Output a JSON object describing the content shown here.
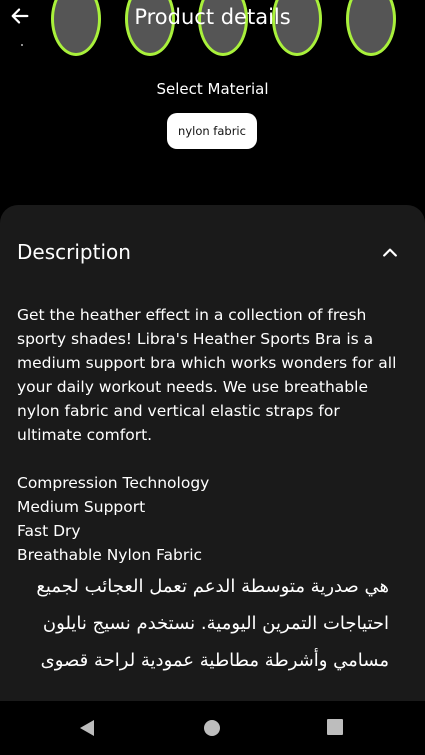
{
  "header": {
    "title": "Product details",
    "back_icon": "arrow-left-icon"
  },
  "colors": {
    "background": "#000000",
    "card": "#1a1a1a",
    "swatch_ring": "#a9f13b",
    "chip_bg": "#ffffff"
  },
  "swatches": [
    {
      "color": "#555555"
    },
    {
      "color": "#555555"
    },
    {
      "color": "#555555"
    },
    {
      "color": "#555555"
    },
    {
      "color": "#555555"
    }
  ],
  "material": {
    "label": "Select Material",
    "selected": "nylon fabric"
  },
  "description": {
    "heading": "Description",
    "toggle_icon": "chevron-up-icon",
    "body": "Get the heather effect in a collection of fresh sporty shades! Libra's Heather Sports Bra is a medium support bra which works wonders for all your daily workout needs. We use breathable nylon fabric and vertical elastic straps for ultimate comfort.",
    "features": [
      "Compression Technology",
      "Medium Support",
      "Fast Dry",
      "Breathable Nylon Fabric"
    ],
    "arabic": "هي صدرية متوسطة الدعم تعمل العجائب لجميع احتياجات التمرين اليومية. نستخدم نسيج نايلون مسامي وأشرطة مطاطية عمودية لراحة قصوى"
  },
  "navbar": {
    "back_icon": "nav-back-triangle-icon",
    "home_icon": "nav-home-circle-icon",
    "recents_icon": "nav-recents-square-icon"
  }
}
